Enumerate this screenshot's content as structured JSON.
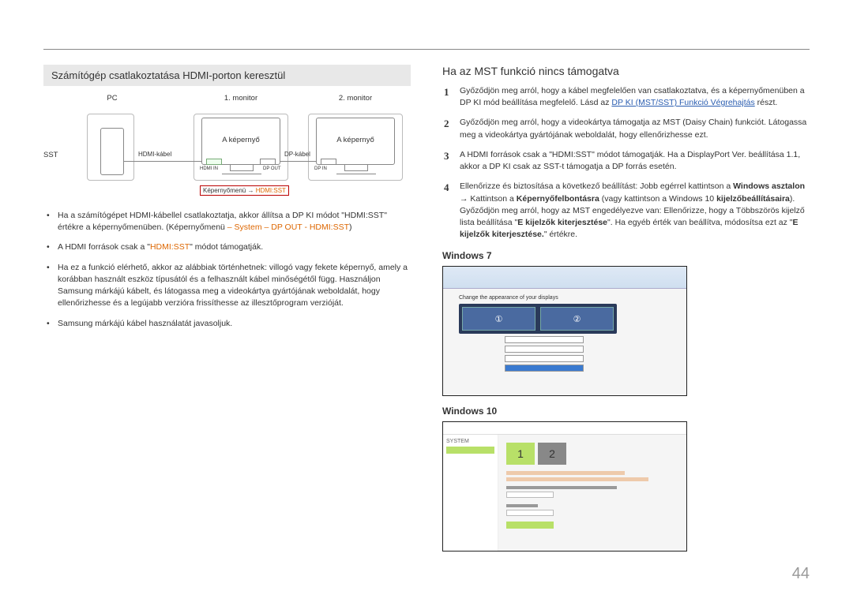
{
  "page_number": "44",
  "left": {
    "heading": "Számítógép csatlakoztatása HDMI-porton keresztül",
    "diagram": {
      "pc": "PC",
      "mon1": "1. monitor",
      "mon2": "2. monitor",
      "sst": "SST",
      "screen": "A képernyő",
      "hdmi_cable": "HDMI-kábel",
      "hdmi_in": "HDMI IN",
      "dp_out": "DP OUT",
      "dp_cable": "DP-kábel",
      "dp_in": "DP IN",
      "menu_prefix": "Képernyőmenü → ",
      "menu_value": "HDMI:SST"
    },
    "bullets": [
      {
        "pre": "Ha a számítógépet HDMI-kábellel csatlakoztatja, akkor állítsa a DP KI módot \"HDMI:SST\" értékre a képernyőmenüben. (Képernyőmenü ",
        "orange": "– System – DP OUT - HDMI:SST",
        "post": ")"
      },
      {
        "pre": "A HDMI források csak a \"",
        "orange": "HDMI:SST",
        "post": "\" módot támogatják."
      },
      {
        "pre": "Ha ez a funkció elérhető, akkor az alábbiak történhetnek: villogó vagy fekete képernyő, amely a korábban használt eszköz típusától és a felhasznált kábel minőségétől függ. Használjon Samsung márkájú kábelt, és látogassa meg a videokártya gyártójának weboldalát, hogy ellenőrizhesse és a legújabb verzióra frissíthesse az illesztőprogram verzióját.",
        "orange": "",
        "post": ""
      },
      {
        "pre": "Samsung márkájú kábel használatát javasoljuk.",
        "orange": "",
        "post": ""
      }
    ]
  },
  "right": {
    "heading": "Ha az MST funkció nincs támogatva",
    "items": [
      {
        "pre": "Győződjön meg arról, hogy a kábel megfelelően van csatlakoztatva, és a képernyőmenüben a DP KI mód beállítása megfelelő. Lásd az ",
        "link": "DP KI (MST/SST) Funkció Végrehajtás",
        "post": " részt."
      },
      {
        "pre": "Győződjön meg arról, hogy a videokártya támogatja az MST (Daisy Chain) funkciót. Látogassa meg a videokártya gyártójának weboldalát, hogy ellenőrizhesse ezt.",
        "link": "",
        "post": ""
      },
      {
        "pre": "A HDMI források csak a \"HDMI:SST\" módot támogatják. Ha a DisplayPort Ver. beállítása 1.1, akkor a DP KI csak az SST-t támogatja a DP forrás esetén.",
        "link": "",
        "post": ""
      },
      {
        "pre": "Ellenőrizze és biztosítása a következő beállítást: Jobb egérrel kattintson a ",
        "b1": "Windows asztalon",
        "mid": " → Kattintson a ",
        "b2": "Képernyőfelbontásra",
        "mid2": " (vagy kattintson a Windows 10 ",
        "b3": "kijelzőbeállításaira",
        "mid3": "). Győződjön meg arról, hogy az MST engedélyezve van: Ellenőrizze, hogy a Többszörös kijelző lista beállítása \"",
        "b4": "E kijelzők kiterjesztése",
        "mid4": "\". Ha egyéb érték van beállítva, módosítsa ezt az \"",
        "b5": "E kijelzők kiterjesztése.",
        "post": "\" értékre."
      }
    ],
    "win7_label": "Windows 7",
    "win10_label": "Windows 10",
    "win7_caption": "Change the appearance of your displays",
    "win10_header": "SYSTEM"
  }
}
